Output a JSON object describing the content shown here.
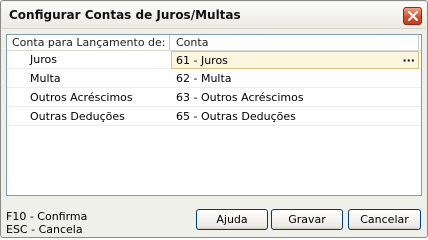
{
  "window": {
    "title": "Configurar Contas de Juros/Multas"
  },
  "grid": {
    "columns": [
      "Conta para Lançamento de:",
      "Conta"
    ],
    "rows": [
      {
        "type": "Juros",
        "account": "61 - Juros",
        "selected": true
      },
      {
        "type": "Multa",
        "account": "62 - Multa"
      },
      {
        "type": "Outros Acréscimos",
        "account": "63 - Outros Acréscimos"
      },
      {
        "type": "Outras Deduções",
        "account": "65 - Outras Deduções"
      }
    ],
    "lookup_label": "···"
  },
  "hints": [
    "F10 - Confirma",
    "ESC - Cancela"
  ],
  "buttons": {
    "help": "Ajuda",
    "save": "Gravar",
    "cancel": "Cancelar"
  },
  "icons": {
    "close": "close-icon"
  }
}
